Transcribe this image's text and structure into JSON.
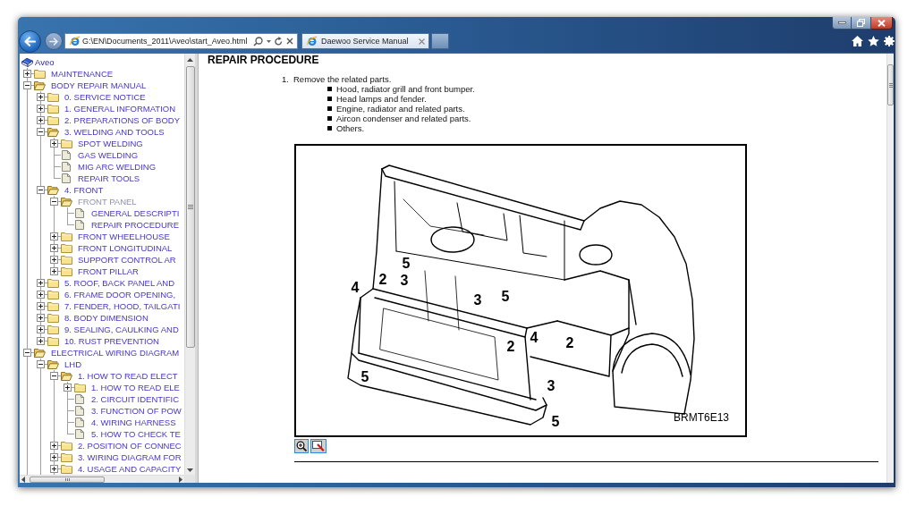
{
  "browser": {
    "address": "G:\\EN\\Documents_2011\\Aveo\\start_Aveo.html",
    "tabs": [
      {
        "label": "Daewoo Service Manual",
        "selected": true
      }
    ]
  },
  "tree": {
    "root": "Aveo",
    "items": [
      {
        "label": "MAINTENANCE",
        "kind": "folder",
        "expanded": false,
        "selected": false
      },
      {
        "label": "BODY REPAIR MANUAL",
        "kind": "folder",
        "expanded": true,
        "selected": false,
        "children": [
          {
            "label": "0. SERVICE NOTICE",
            "kind": "folder",
            "expanded": false,
            "selected": false
          },
          {
            "label": "1. GENERAL INFORMATION",
            "kind": "folder",
            "expanded": false,
            "selected": false
          },
          {
            "label": "2. PREPARATIONS OF BODY",
            "kind": "folder",
            "expanded": false,
            "selected": false
          },
          {
            "label": "3. WELDING AND TOOLS",
            "kind": "folder",
            "expanded": true,
            "selected": false,
            "children": [
              {
                "label": "SPOT WELDING",
                "kind": "folder",
                "expanded": false,
                "selected": false
              },
              {
                "label": "GAS WELDING",
                "kind": "page",
                "selected": false
              },
              {
                "label": "MIG ARC WELDING",
                "kind": "page",
                "selected": false
              },
              {
                "label": "REPAIR TOOLS",
                "kind": "page",
                "selected": false
              }
            ]
          },
          {
            "label": "4. FRONT",
            "kind": "folder",
            "expanded": true,
            "selected": false,
            "children": [
              {
                "label": "FRONT PANEL",
                "kind": "folder",
                "expanded": true,
                "selected": true,
                "children": [
                  {
                    "label": "GENERAL DESCRIPTI",
                    "kind": "page",
                    "selected": false
                  },
                  {
                    "label": "REPAIR PROCEDURE",
                    "kind": "page",
                    "selected": false
                  }
                ]
              },
              {
                "label": "FRONT WHEELHOUSE",
                "kind": "folder",
                "expanded": false,
                "selected": false
              },
              {
                "label": "FRONT LONGITUDINAL",
                "kind": "folder",
                "expanded": false,
                "selected": false
              },
              {
                "label": "SUPPORT CONTROL AR",
                "kind": "folder",
                "expanded": false,
                "selected": false
              },
              {
                "label": "FRONT PILLAR",
                "kind": "folder",
                "expanded": false,
                "selected": false
              }
            ]
          },
          {
            "label": "5. ROOF, BACK PANEL AND",
            "kind": "folder",
            "expanded": false,
            "selected": false
          },
          {
            "label": "6. FRAME DOOR OPENING,",
            "kind": "folder",
            "expanded": false,
            "selected": false
          },
          {
            "label": "7. FENDER, HOOD, TAILGATI",
            "kind": "folder",
            "expanded": false,
            "selected": false
          },
          {
            "label": "8. BODY DIMENSION",
            "kind": "folder",
            "expanded": false,
            "selected": false
          },
          {
            "label": "9. SEALING, CAULKING AND",
            "kind": "folder",
            "expanded": false,
            "selected": false
          },
          {
            "label": "10. RUST PREVENTION",
            "kind": "folder",
            "expanded": false,
            "selected": false
          }
        ]
      },
      {
        "label": "ELECTRICAL WIRING DIAGRAM",
        "kind": "folder",
        "expanded": true,
        "selected": false,
        "children": [
          {
            "label": "LHD",
            "kind": "folder",
            "expanded": true,
            "selected": false,
            "children": [
              {
                "label": "1. HOW TO READ ELECT",
                "kind": "folder",
                "expanded": true,
                "selected": false,
                "children": [
                  {
                    "label": "1. HOW TO READ ELE",
                    "kind": "folder",
                    "expanded": false,
                    "selected": false
                  },
                  {
                    "label": "2. CIRCUIT IDENTIFIC",
                    "kind": "page",
                    "selected": false
                  },
                  {
                    "label": "3. FUNCTION OF POW",
                    "kind": "page",
                    "selected": false
                  },
                  {
                    "label": "4. WIRING HARNESS",
                    "kind": "page",
                    "selected": false
                  },
                  {
                    "label": "5. HOW TO CHECK TE",
                    "kind": "page",
                    "selected": false
                  }
                ]
              },
              {
                "label": "2. POSITION OF CONNEC",
                "kind": "folder",
                "expanded": false,
                "selected": false
              },
              {
                "label": "3. WIRING DIAGRAM FOR",
                "kind": "folder",
                "expanded": false,
                "selected": false
              },
              {
                "label": "4. USAGE AND CAPACITY",
                "kind": "folder",
                "expanded": false,
                "selected": false
              }
            ]
          }
        ]
      }
    ]
  },
  "content": {
    "heading": "REPAIR PROCEDURE",
    "steps": [
      {
        "number": "1.",
        "text": "Remove the related parts.",
        "bullets": [
          "Hood, radiator grill and front bumper.",
          "Head lamps and fender.",
          "Engine, radiator and related parts.",
          "Aircon condenser and related parts.",
          "Others."
        ]
      }
    ],
    "figure": {
      "callouts": [
        "5",
        "4",
        "2",
        "3",
        "3",
        "5",
        "2",
        "4",
        "2",
        "5",
        "3",
        "5"
      ],
      "code": "BRMT6E13"
    }
  }
}
